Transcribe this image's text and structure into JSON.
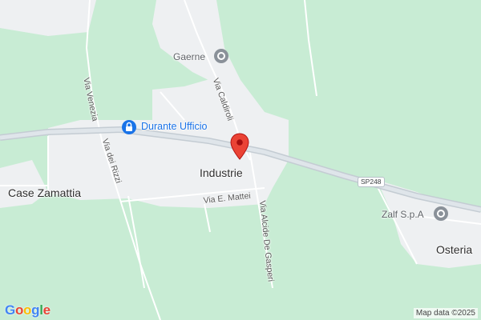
{
  "map": {
    "places": {
      "industrie": "Industrie",
      "case_zamattia": "Case Zamattia",
      "osteria": "Osteria"
    },
    "pois": {
      "gaerne": "Gaerne",
      "durante_ufficio": "Durante Ufficio",
      "zalf": "Zalf S.p.A"
    },
    "streets": {
      "via_caldiroli": "Via Caldiroli",
      "via_venezia": "Via Venezia",
      "via_dei_rizzi": "Via dei Rizzi",
      "via_mattei": "Via E. Mattei",
      "via_de_gasperi": "Via Alcide De Gasperi"
    },
    "road_shield": "SP248",
    "logo": "Google",
    "credit": "Map data ©2025",
    "colors": {
      "greenery": "#c8ecd4",
      "urban": "#eef0f2",
      "road": "#ffffff",
      "highway": "#d6dde3",
      "marker": "#ea4335",
      "poi_blue": "#1a73e8"
    }
  }
}
